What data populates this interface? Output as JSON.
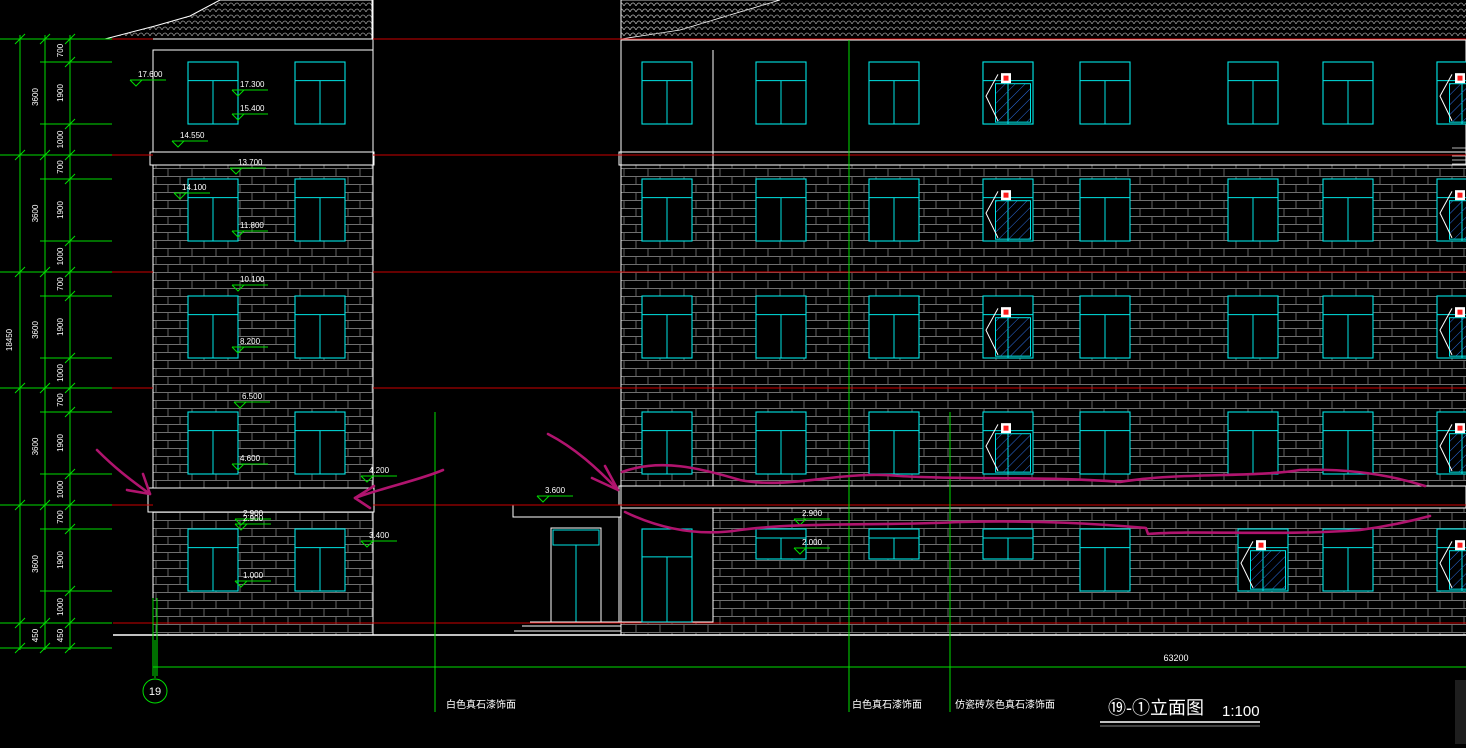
{
  "colors": {
    "background": "#000000",
    "outline": "#ffffff",
    "window": "#00e5e5",
    "dimension": "#00dd00",
    "floor_line": "#cc0000",
    "brick": "#6f6f6f",
    "annotation": "#b0146e",
    "marker": "#ff1a1a"
  },
  "drawing": {
    "title_axis": "⑲-①立面图",
    "title_scale": "1:100",
    "grid_bubble": "19",
    "overall_width": "63200",
    "overall_height": "18450"
  },
  "elevations": [
    {
      "text": "17.600"
    },
    {
      "text": "17.300"
    },
    {
      "text": "15.400"
    },
    {
      "text": "14.550"
    },
    {
      "text": "13.700"
    },
    {
      "text": "14.100"
    },
    {
      "text": "11.800"
    },
    {
      "text": "10.100"
    },
    {
      "text": "8.200"
    },
    {
      "text": "6.500"
    },
    {
      "text": "4.600"
    },
    {
      "text": "4.200"
    },
    {
      "text": "2.900"
    },
    {
      "text": "2.900"
    },
    {
      "text": "3.400"
    },
    {
      "text": "1.000"
    },
    {
      "text": "3.600"
    },
    {
      "text": "2.900"
    },
    {
      "text": "2.000"
    }
  ],
  "left_dimensions": {
    "outer": [
      "3600",
      "3600",
      "3600",
      "3600",
      "3600",
      "450"
    ],
    "inner": [
      "700",
      "1900",
      "1000",
      "700",
      "1900",
      "1000",
      "700",
      "1900",
      "1000",
      "700",
      "1900",
      "1000",
      "700",
      "1900",
      "1000",
      "450"
    ]
  },
  "material_notes": [
    {
      "text": "白色真石漆饰面"
    },
    {
      "text": "白色真石漆饰面"
    },
    {
      "text": "仿瓷砖灰色真石漆饰面"
    }
  ]
}
